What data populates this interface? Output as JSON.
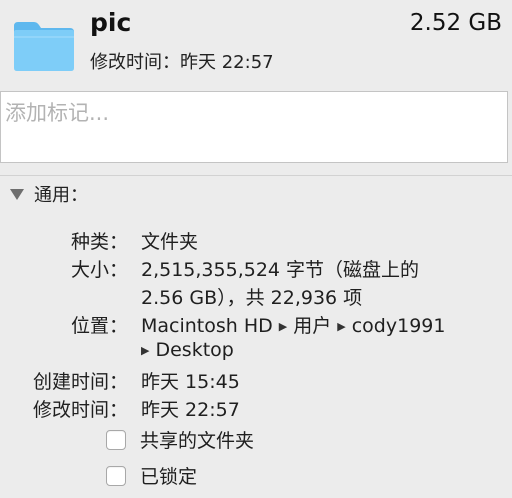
{
  "header": {
    "icon": "folder-icon",
    "name": "pic",
    "size": "2.52 GB",
    "modified": "修改时间：昨天 22:57"
  },
  "tags": {
    "placeholder": "添加标记..."
  },
  "general": {
    "title": "通用：",
    "rows": {
      "kind": {
        "label": "种类：",
        "value": "文件夹"
      },
      "size": {
        "label": "大小：",
        "value_line1": "2,515,355,524 字节（磁盘上的",
        "value_line2": "2.56 GB），共 22,936 项"
      },
      "where": {
        "label": "位置：",
        "segments": [
          "Macintosh HD",
          "用户",
          "cody1991",
          "Desktop"
        ]
      },
      "created": {
        "label": "创建时间：",
        "value": "昨天 15:45"
      },
      "modified": {
        "label": "修改时间：",
        "value": "昨天 22:57"
      }
    },
    "checkboxes": {
      "shared_folder": "共享的文件夹",
      "locked": "已锁定"
    }
  },
  "colors": {
    "window_bg": "#ececec",
    "folder_blue": "#6cc3f5"
  }
}
